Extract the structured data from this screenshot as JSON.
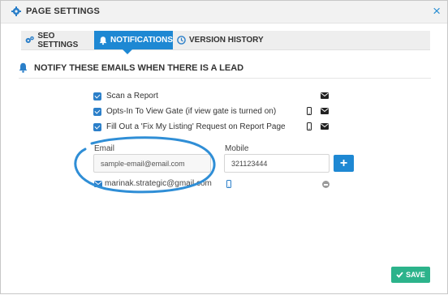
{
  "window": {
    "title": "PAGE SETTINGS",
    "close_symbol": "×"
  },
  "tabs": [
    {
      "label": "SEO SETTINGS",
      "icon": "gears-icon",
      "active": false
    },
    {
      "label": "NOTIFICATIONS",
      "icon": "bell-icon",
      "active": true
    },
    {
      "label": "VERSION HISTORY",
      "icon": "clock-icon",
      "active": false
    }
  ],
  "section": {
    "heading": "NOTIFY THESE EMAILS WHEN THERE IS A LEAD"
  },
  "options": [
    {
      "label": "Scan a Report",
      "checked": true,
      "channels": [
        "email"
      ]
    },
    {
      "label": "Opts-In To View Gate (if view gate is turned on)",
      "checked": true,
      "channels": [
        "mobile",
        "email"
      ]
    },
    {
      "label": "Fill Out a 'Fix My Listing' Request on Report Page",
      "checked": true,
      "channels": [
        "mobile",
        "email"
      ]
    }
  ],
  "form": {
    "email_label": "Email",
    "mobile_label": "Mobile",
    "email_value": "sample-email@email.com",
    "mobile_value": "321123444",
    "add_label": "+"
  },
  "recipients": [
    {
      "email": "marinak.strategic@gmail.com",
      "has_mobile": true
    }
  ],
  "footer": {
    "save_label": "SAVE"
  },
  "colors": {
    "accent": "#1e88d3",
    "save": "#2cb38b",
    "annotation": "#2f8ed6"
  }
}
